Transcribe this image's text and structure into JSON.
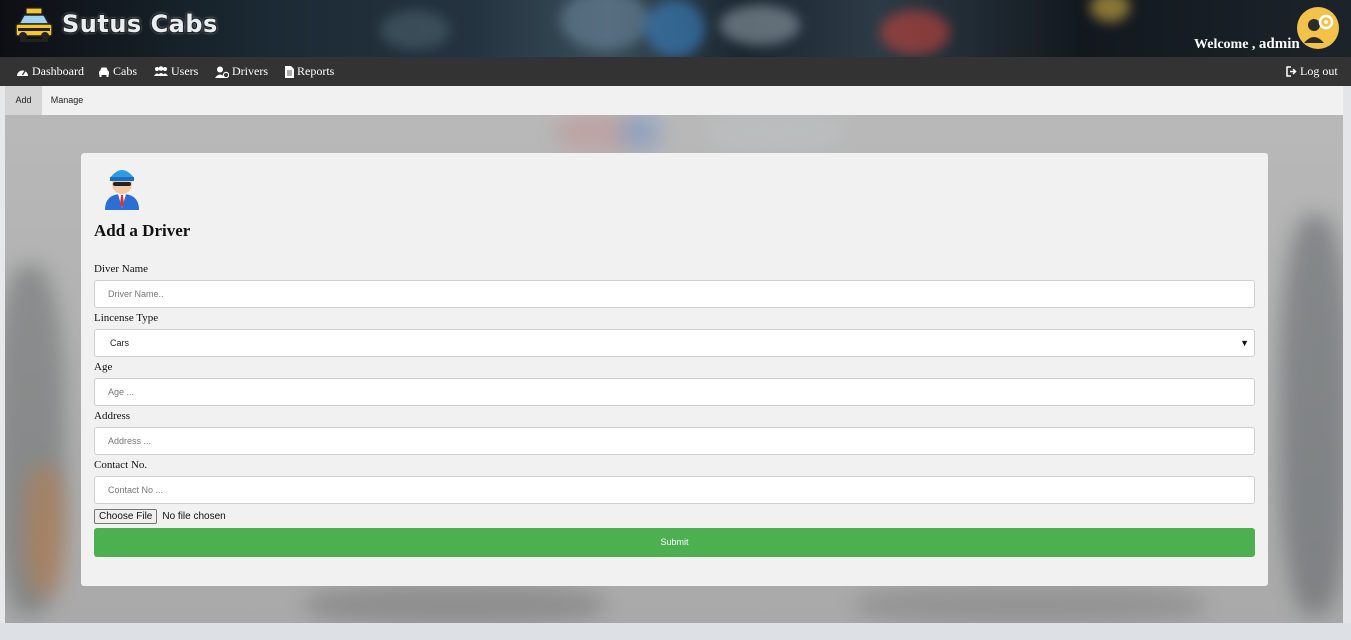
{
  "app": {
    "brand": "Sutus Cabs",
    "welcome_prefix": "Welcome ,",
    "username": "admin"
  },
  "nav": {
    "items": [
      {
        "label": "Dashboard",
        "icon": "dashboard-icon"
      },
      {
        "label": "Cabs",
        "icon": "car-icon"
      },
      {
        "label": "Users",
        "icon": "users-icon"
      },
      {
        "label": "Drivers",
        "icon": "driver-icon"
      },
      {
        "label": "Reports",
        "icon": "document-icon"
      }
    ],
    "logout": {
      "label": "Log out",
      "icon": "sign-out-icon"
    }
  },
  "subtabs": [
    {
      "label": "Add",
      "active": true
    },
    {
      "label": "Manage",
      "active": false
    }
  ],
  "form": {
    "title": "Add a Driver",
    "fields": {
      "name": {
        "label": "Diver Name",
        "placeholder": "Driver Name.."
      },
      "license": {
        "label": "Lincense Type",
        "selected": "Cars"
      },
      "age": {
        "label": "Age",
        "placeholder": "Age ..."
      },
      "address": {
        "label": "Address",
        "placeholder": "Address ..."
      },
      "contact": {
        "label": "Contact No.",
        "placeholder": "Contact No ..."
      }
    },
    "file": {
      "button": "Choose File",
      "status": "No file chosen"
    },
    "submit": "Submit"
  },
  "colors": {
    "nav_bg": "#333333",
    "submit_bg": "#4caf50",
    "avatar_bg": "#f3c24b"
  }
}
